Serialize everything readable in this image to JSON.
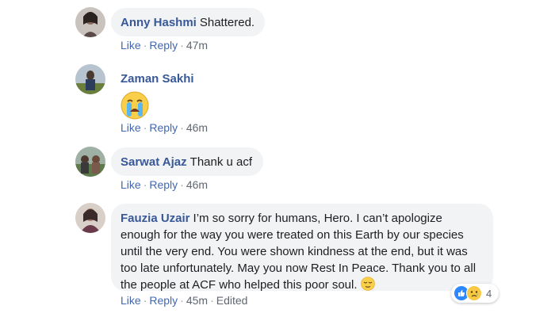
{
  "comments": [
    {
      "author": "Anny Hashmi",
      "text": "Shattered.",
      "like": "Like",
      "reply": "Reply",
      "time": "47m"
    },
    {
      "author": "Zaman Sakhi",
      "sticker": "crying-face-emoji",
      "like": "Like",
      "reply": "Reply",
      "time": "46m"
    },
    {
      "author": "Sarwat Ajaz",
      "text": "Thank u acf",
      "like": "Like",
      "reply": "Reply",
      "time": "46m"
    },
    {
      "author": "Fauzia Uzair",
      "text_line1": "I’m so sorry for humans, Hero. I can’t apologize",
      "text_line2": "enough for the way you were treated on this Earth by our species",
      "text_line3": "until the very end. You were shown kindness at the end, but it was",
      "text_line4": "too late unfortunately. May you now Rest In Peace. Thank you to all",
      "text_line5": "the people at ACF who helped this poor soul.",
      "trailing_emoji": "relieved-face-emoji",
      "like": "Like",
      "reply": "Reply",
      "time": "45m",
      "edited": "Edited",
      "reaction_count": "4",
      "reaction_icons": [
        "like-reaction-icon",
        "sad-reaction-icon"
      ]
    }
  ],
  "colors": {
    "link_blue": "#385898",
    "action_blue": "#4267b2",
    "bubble_bg": "#f2f3f5",
    "meta_gray": "#606770"
  }
}
